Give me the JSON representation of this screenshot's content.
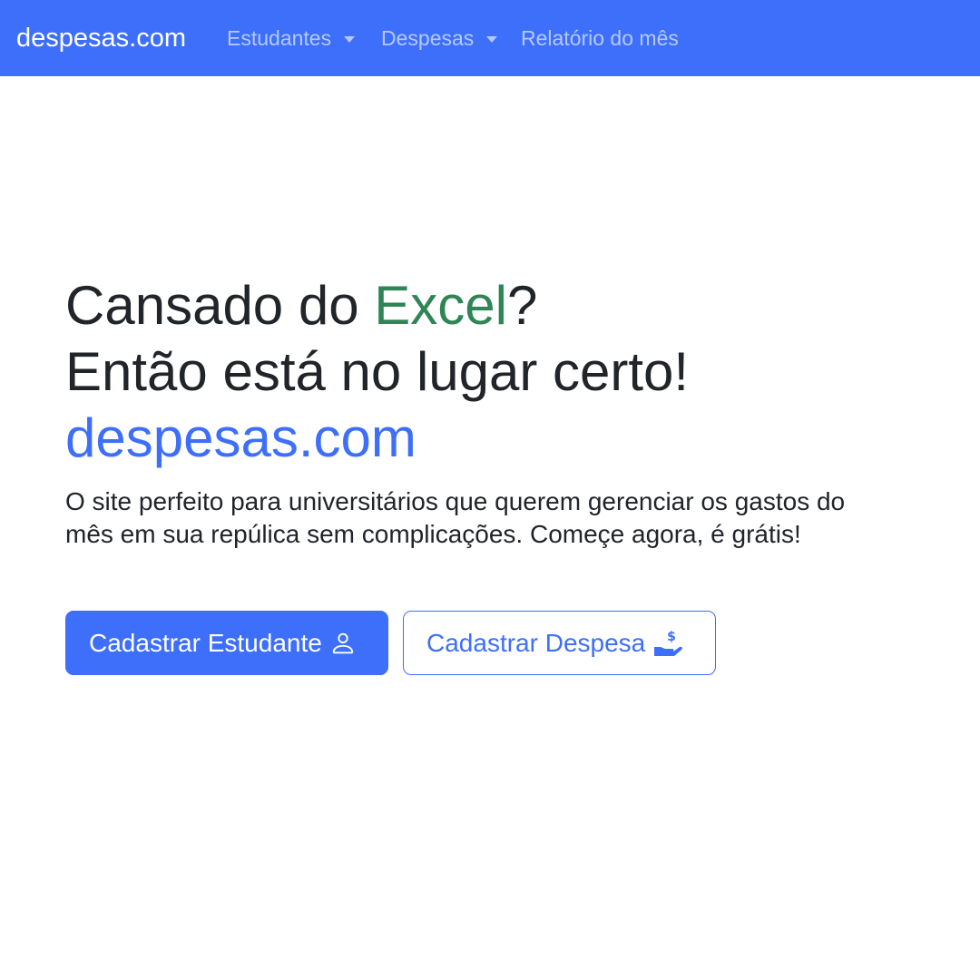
{
  "navbar": {
    "brand": "despesas.com",
    "items": [
      {
        "label": "Estudantes",
        "dropdown": true
      },
      {
        "label": "Despesas",
        "dropdown": true
      },
      {
        "label": "Relatório do mês",
        "dropdown": false
      }
    ]
  },
  "hero": {
    "line1_prefix": "Cansado do ",
    "line1_highlight": "Excel",
    "line1_suffix": "?",
    "line2": "Então está no lugar certo!",
    "line3": "despesas.com",
    "lead": "O site perfeito para universitários que querem gerenciar os gastos do mês em sua repúlica sem complicações. Começe agora, é grátis!"
  },
  "buttons": {
    "primary_label": "Cadastrar Estudante",
    "primary_icon": "person-icon",
    "secondary_label": "Cadastrar Despesa",
    "secondary_icon": "cash-hand-icon"
  },
  "colors": {
    "brand": "#3d6ffb",
    "excel_green": "#2e8555",
    "text": "#212529"
  }
}
